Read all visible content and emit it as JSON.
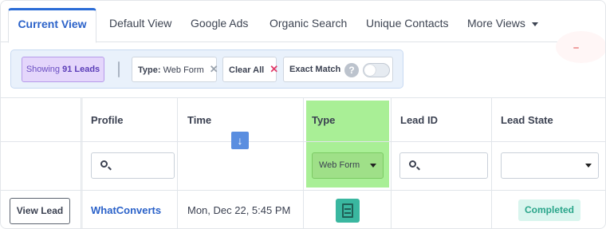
{
  "tabs": [
    {
      "label": "Current View",
      "active": true
    },
    {
      "label": "Default View"
    },
    {
      "label": "Google Ads"
    },
    {
      "label": "Organic Search"
    },
    {
      "label": "Unique Contacts"
    },
    {
      "label": "More Views",
      "icon": "chevron-down-icon"
    }
  ],
  "filters": {
    "showing_prefix": "Showing",
    "showing_count": "91 Leads",
    "type_key": "Type:",
    "type_value": "Web Form",
    "remove_glyph": "✕",
    "clear_all": "Clear All",
    "exact_match": "Exact Match",
    "help_glyph": "?",
    "exact_match_on": false
  },
  "table": {
    "headers": {
      "profile": "Profile",
      "time": "Time",
      "type": "Type",
      "lead_id": "Lead ID",
      "lead_state": "Lead State"
    },
    "filters": {
      "type_select": "Web Form",
      "sort_glyph": "↓",
      "sort_direction": "descending"
    },
    "rows": [
      {
        "action": "View Lead",
        "profile": "WhatConverts",
        "time": "Mon, Dec 22, 5:45 PM",
        "type_icon": "form-icon",
        "lead_id": "",
        "lead_state": "Completed"
      }
    ]
  },
  "colors": {
    "accent": "#2b62c9",
    "type_column_highlight": "#a9ef96",
    "completed_badge": "#d9f5ee",
    "leads_chip": "#e4d6fb"
  }
}
